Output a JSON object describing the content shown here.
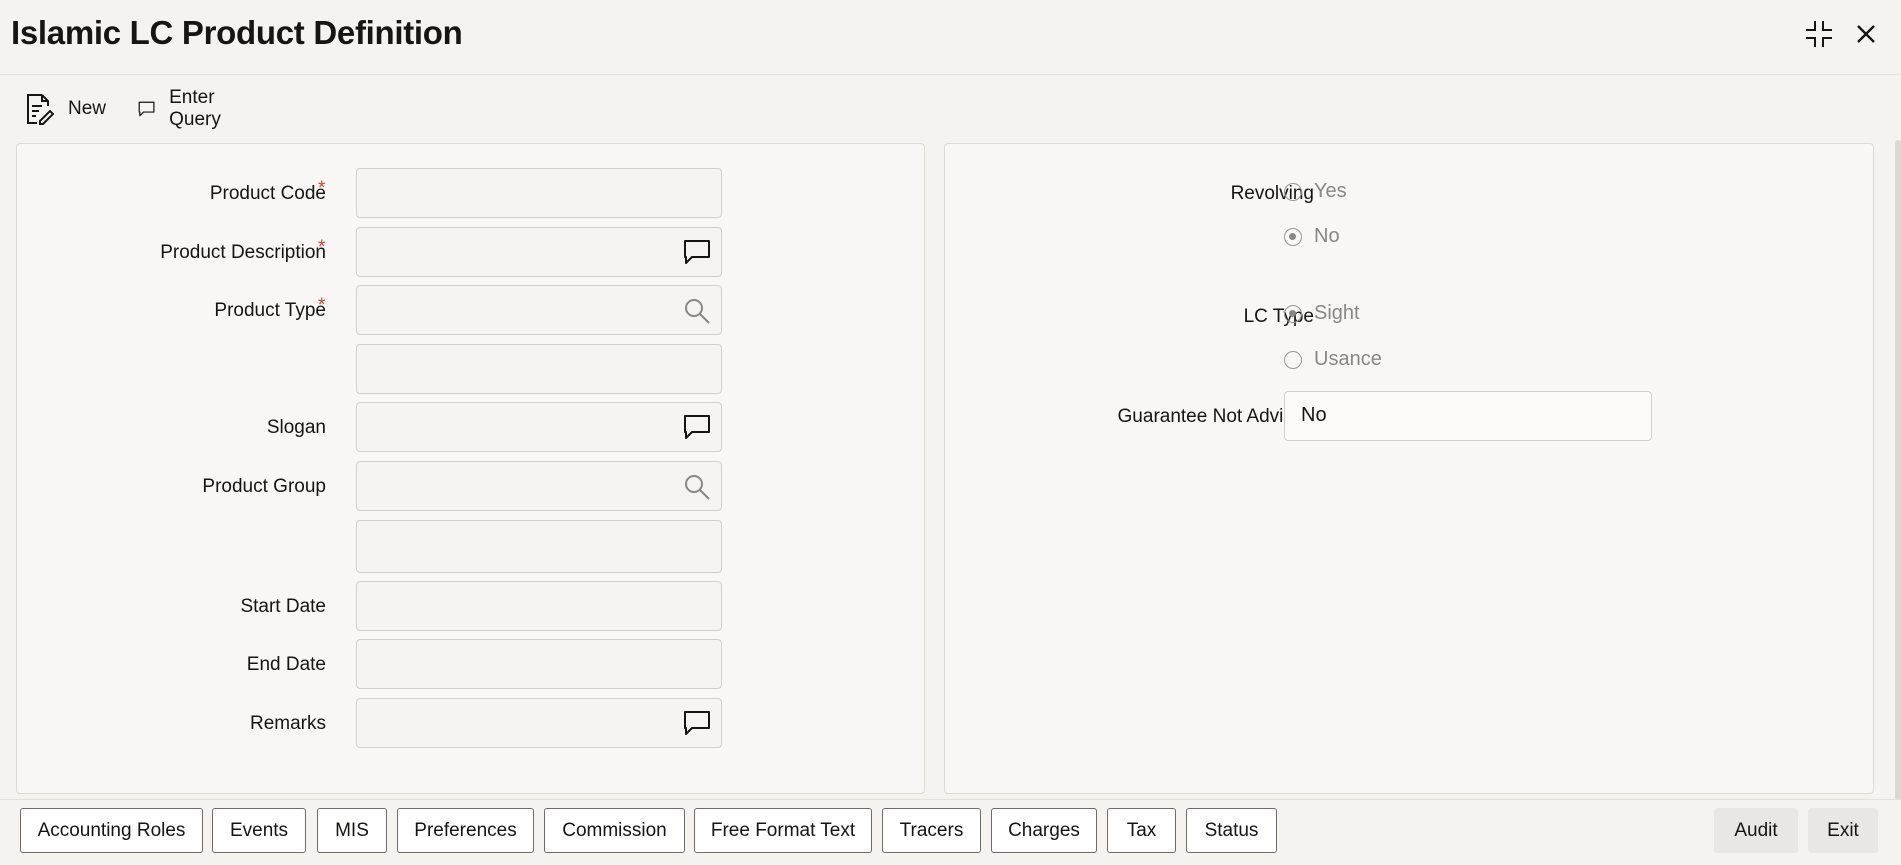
{
  "window": {
    "title": "Islamic LC Product Definition"
  },
  "toolbar": {
    "new_label": "New",
    "enter_query_label": "Enter Query"
  },
  "left_form": {
    "product_code": {
      "label": "Product Code",
      "required": "*",
      "value": ""
    },
    "product_description": {
      "label": "Product Description",
      "required": "*",
      "value": ""
    },
    "product_type": {
      "label": "Product Type",
      "required": "*",
      "value": "",
      "description": ""
    },
    "slogan": {
      "label": "Slogan",
      "value": ""
    },
    "product_group": {
      "label": "Product Group",
      "value": "",
      "description": ""
    },
    "start_date": {
      "label": "Start Date",
      "value": ""
    },
    "end_date": {
      "label": "End Date",
      "value": ""
    },
    "remarks": {
      "label": "Remarks",
      "value": ""
    }
  },
  "right_form": {
    "revolving": {
      "label": "Revolving",
      "options": [
        "Yes",
        "No"
      ],
      "selected": "No"
    },
    "lc_type": {
      "label": "LC Type",
      "options": [
        "Sight",
        "Usance"
      ],
      "selected": "Sight"
    },
    "guarantee_not_advised": {
      "label": "Guarantee Not Advised",
      "value": "No"
    }
  },
  "bottom_buttons": [
    "Accounting Roles",
    "Events",
    "MIS",
    "Preferences",
    "Commission",
    "Free Format Text",
    "Tracers",
    "Charges",
    "Tax",
    "Status"
  ],
  "bottom_right_buttons": [
    "Audit",
    "Exit"
  ],
  "icons": [
    "new-document-icon",
    "enter-query-icon",
    "maximize-icon",
    "close-icon",
    "comment-icon",
    "search-icon"
  ]
}
